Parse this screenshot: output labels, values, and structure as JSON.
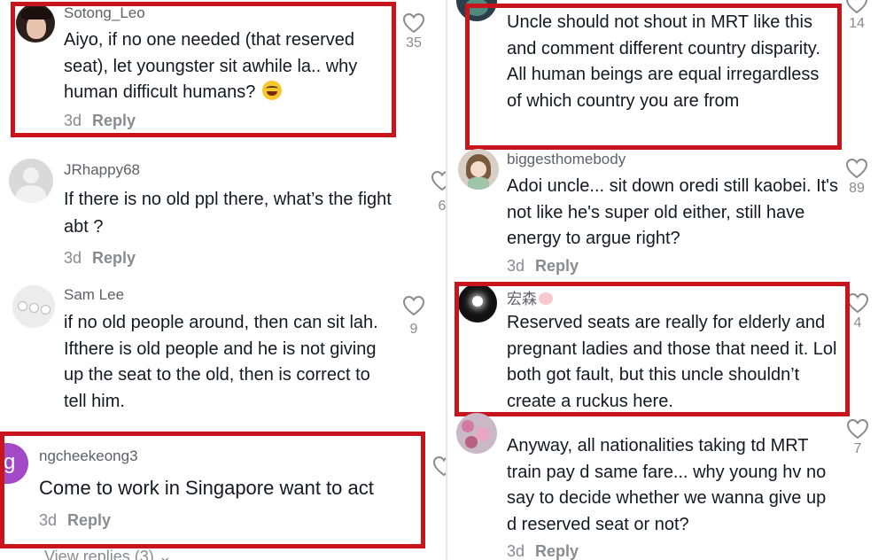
{
  "left": {
    "comments": [
      {
        "username": "Sotong_Leo",
        "text": "Aiyo, if no one needed (that reserved seat), let youngster sit awhile la.. why human difficult humans?",
        "age": "3d",
        "reply": "Reply",
        "likes": "35"
      },
      {
        "username": "JRhappy68",
        "text": "If there is no old ppl there, what’s the fight abt ?",
        "age": "3d",
        "reply": "Reply",
        "likes": "6"
      },
      {
        "username": "Sam Lee",
        "text": "if no old people around, then can sit lah. Ifthere is old people and he is not giving up the seat to the old, then is correct to tell him.",
        "age": "",
        "reply": "",
        "likes": "9"
      },
      {
        "username": "ngcheekeong3",
        "text": "Come to work in Singapore want to act",
        "age": "3d",
        "reply": "Reply",
        "likes": ""
      }
    ],
    "view_replies": "View replies (3)",
    "avatar_letter": "g"
  },
  "right": {
    "comments": [
      {
        "username": "",
        "text": "Uncle should not shout in MRT like this and comment different country disparity. All human beings are equal irregardless of which country you are from",
        "likes": "14"
      },
      {
        "username": "biggesthomebody",
        "text": "Adoi uncle... sit down oredi still kaobei. It's not like he's super old either, still have energy to argue right?",
        "age": "3d",
        "reply": "Reply",
        "likes": "89"
      },
      {
        "username": "宏森",
        "text": "Reserved seats are really for elderly and pregnant ladies and those that need it. Lol both got fault, but this uncle shouldn’t create a ruckus here.",
        "likes": "4"
      },
      {
        "username": "",
        "text": "Anyway, all nationalities taking td MRT train pay d same fare... why young hv no say to decide whether we wanna give up d reserved seat or not?",
        "age": "3d",
        "reply": "Reply",
        "likes": "7"
      }
    ]
  },
  "colors": {
    "highlight": "#c8141c",
    "text": "#161823",
    "muted": "#8a8b91"
  }
}
